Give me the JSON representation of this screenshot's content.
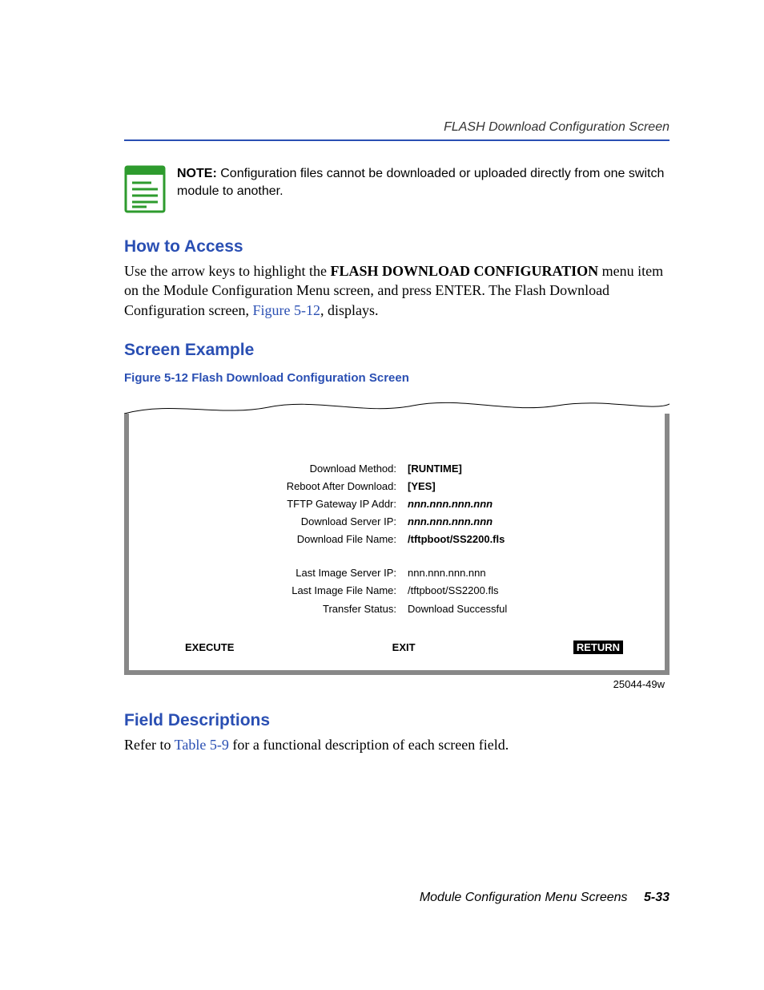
{
  "header": {
    "running_title": "FLASH Download Configuration Screen"
  },
  "note": {
    "label": "NOTE:",
    "text": "Configuration files cannot be downloaded or uploaded directly from one switch module to another."
  },
  "sections": {
    "how_to_access": {
      "heading": "How to Access",
      "para_pre": "Use the arrow keys to highlight the ",
      "menu_item": "FLASH DOWNLOAD CONFIGURATION",
      "para_mid": " menu item on the Module Configuration Menu screen, and press ENTER. The Flash Download Configuration screen, ",
      "figref": "Figure 5-12",
      "para_post": ", displays."
    },
    "screen_example": {
      "heading": "Screen Example",
      "figure_caption": "Figure 5-12   Flash Download Configuration Screen",
      "figure_id": "25044-49w"
    },
    "field_descriptions": {
      "heading": "Field Descriptions",
      "para_pre": "Refer to ",
      "tableref": "Table 5-9",
      "para_post": " for a functional description of each screen field."
    }
  },
  "screen": {
    "rows1": [
      {
        "label": "Download Method:",
        "value": "[RUNTIME]",
        "style": "bold"
      },
      {
        "label": "Reboot After Download:",
        "value": "[YES]",
        "style": "bold"
      },
      {
        "label": "TFTP Gateway IP Addr:",
        "value": "nnn.nnn.nnn.nnn",
        "style": "italic"
      },
      {
        "label": "Download Server IP:",
        "value": "nnn.nnn.nnn.nnn",
        "style": "italic"
      },
      {
        "label": "Download File Name:",
        "value": "/tftpboot/SS2200.fls",
        "style": "bold"
      }
    ],
    "rows2": [
      {
        "label": "Last Image Server IP:",
        "value": "nnn.nnn.nnn.nnn",
        "style": ""
      },
      {
        "label": "Last Image File Name:",
        "value": "/tftpboot/SS2200.fls",
        "style": ""
      },
      {
        "label": "Transfer Status:",
        "value": "Download Successful",
        "style": ""
      }
    ],
    "buttons": {
      "execute": "EXECUTE",
      "exit": "EXIT",
      "return": "RETURN"
    }
  },
  "footer": {
    "text": "Module Configuration Menu Screens",
    "page": "5-33"
  }
}
